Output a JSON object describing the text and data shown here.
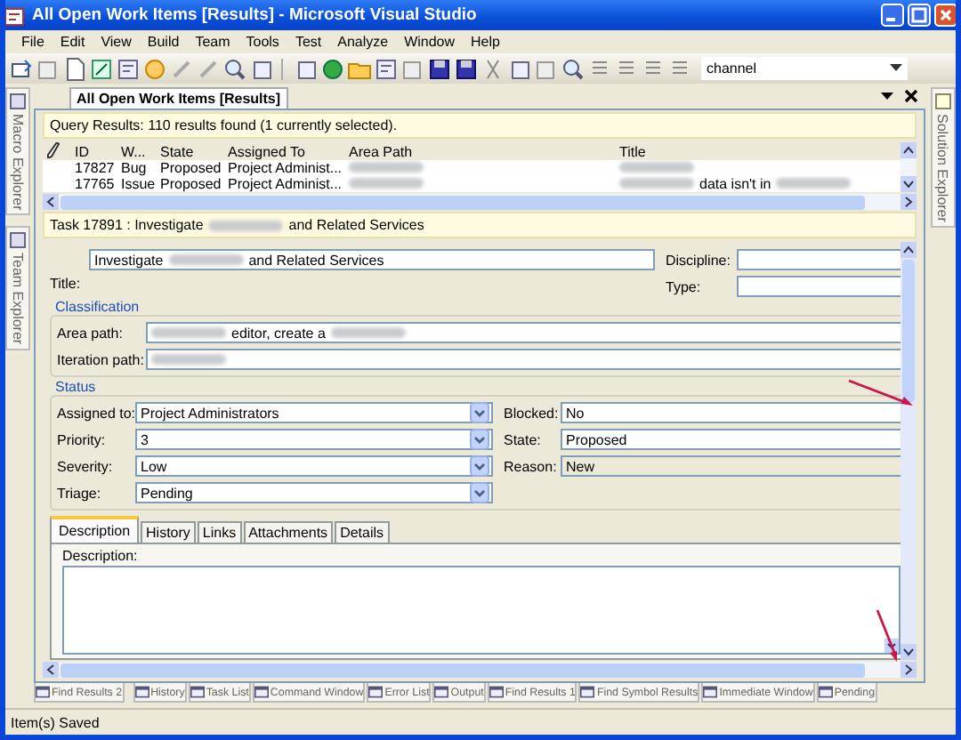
{
  "window": {
    "title": "All Open Work Items [Results] - Microsoft Visual Studio"
  },
  "menu": [
    "File",
    "Edit",
    "View",
    "Build",
    "Team",
    "Tools",
    "Test",
    "Analyze",
    "Window",
    "Help"
  ],
  "toolbar": {
    "combo_value": "channel"
  },
  "side_tabs_left": [
    "Macro Explorer",
    "Team Explorer"
  ],
  "side_tabs_right": [
    "Solution Explorer"
  ],
  "document_tab": {
    "label": "All Open Work Items [Results]"
  },
  "query": {
    "summary": "Query Results: 110 results found (1 currently selected).",
    "columns": [
      "ID",
      "W...",
      "State",
      "Assigned To",
      "Area Path",
      "Title"
    ],
    "rows": [
      [
        [
          {
            "kind": "text",
            "text": "17827"
          }
        ],
        [
          {
            "kind": "text",
            "text": "Bug"
          }
        ],
        [
          {
            "kind": "text",
            "text": "Proposed"
          }
        ],
        [
          {
            "kind": "text",
            "text": "Project Administ..."
          }
        ],
        [
          {
            "kind": "redacted"
          }
        ],
        [
          {
            "kind": "redacted"
          }
        ]
      ],
      [
        [
          {
            "kind": "text",
            "text": "17765"
          }
        ],
        [
          {
            "kind": "text",
            "text": "Issue"
          }
        ],
        [
          {
            "kind": "text",
            "text": "Proposed"
          }
        ],
        [
          {
            "kind": "text",
            "text": "Project Administ..."
          }
        ],
        [
          {
            "kind": "redacted"
          }
        ],
        [
          {
            "kind": "redacted"
          },
          {
            "kind": "text",
            "text": "data isn't in"
          },
          {
            "kind": "redacted"
          }
        ]
      ]
    ]
  },
  "work_item": {
    "header": [
      {
        "kind": "text",
        "text": "Task 17891 : Investigate"
      },
      {
        "kind": "redacted"
      },
      {
        "kind": "text",
        "text": "and Related Services"
      }
    ],
    "title_label": "Title:",
    "title_value": [
      {
        "kind": "text",
        "text": "Investigate"
      },
      {
        "kind": "redacted"
      },
      {
        "kind": "text",
        "text": "and Related Services"
      }
    ],
    "side_fields": [
      {
        "label": "Discipline:"
      },
      {
        "label": "Type:"
      }
    ],
    "classification": {
      "heading": "Classification",
      "fields": [
        {
          "label": "Area path:",
          "value": [
            {
              "kind": "redacted"
            },
            {
              "kind": "text",
              "text": "editor, create a"
            },
            {
              "kind": "redacted"
            }
          ]
        },
        {
          "label": "Iteration path:",
          "value": [
            {
              "kind": "redacted"
            }
          ]
        }
      ]
    },
    "status": {
      "heading": "Status",
      "left": [
        {
          "label": "Assigned to:",
          "value": "Project Administrators"
        },
        {
          "label": "Priority:",
          "value": "3"
        },
        {
          "label": "Severity:",
          "value": "Low"
        },
        {
          "label": "Triage:",
          "value": "Pending"
        }
      ],
      "right": [
        {
          "label": "Blocked:",
          "value": "No",
          "disabled": false
        },
        {
          "label": "State:",
          "value": "Proposed",
          "disabled": false
        },
        {
          "label": "Reason:",
          "value": "New",
          "disabled": true
        }
      ]
    },
    "tabs": [
      {
        "label": "Description",
        "selected": true
      },
      {
        "label": "History",
        "selected": false
      },
      {
        "label": "Links",
        "selected": false
      },
      {
        "label": "Attachments",
        "selected": false
      },
      {
        "label": "Details",
        "selected": false
      }
    ],
    "description_label": "Description:"
  },
  "bottom_tabs": [
    {
      "label": "Find Results 2"
    },
    {
      "label": "History"
    },
    {
      "label": "Task List"
    },
    {
      "label": "Command Window"
    },
    {
      "label": "Error List"
    },
    {
      "label": "Output"
    },
    {
      "label": "Find Results 1"
    },
    {
      "label": "Find Symbol Results"
    },
    {
      "label": "Immediate Window"
    },
    {
      "label": "Pending"
    }
  ],
  "status_bar": "Item(s) Saved"
}
